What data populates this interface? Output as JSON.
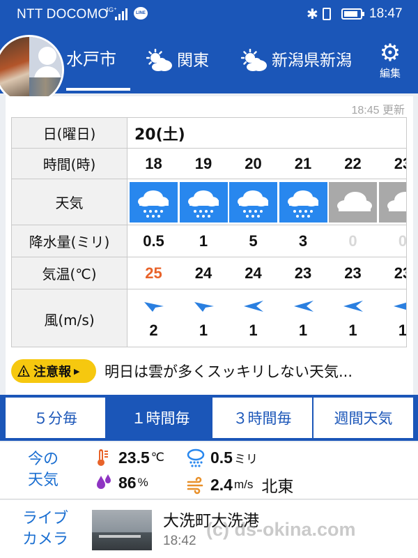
{
  "status_bar": {
    "carrier": "NTT DOCOMO",
    "network": "4G⁺",
    "line_app": "LINE",
    "time": "18:47",
    "battery_level": 0.85
  },
  "header": {
    "city_tab": "水戸市",
    "region_tabs": [
      {
        "label": "関東",
        "icon": "sun-cloud-icon"
      },
      {
        "label": "新潟県新潟",
        "icon": "sun-cloud-icon"
      }
    ],
    "settings_label": "編集",
    "accent_color": "#1b56b8"
  },
  "forecast": {
    "updated": "18:45 更新",
    "labels": {
      "date": "日(曜日)",
      "hour": "時間(時)",
      "weather": "天気",
      "precip": "降水量(ミリ)",
      "temp": "気温(℃)",
      "wind": "風(m/s)"
    },
    "date": "20(土)",
    "hours": [
      "18",
      "19",
      "20",
      "21",
      "22",
      "23"
    ],
    "weather": [
      "rain",
      "rain",
      "rain",
      "rain",
      "cloud",
      "cloud"
    ],
    "precip": [
      "0.5",
      "1",
      "5",
      "3",
      "0",
      "0"
    ],
    "temps": [
      "25",
      "24",
      "24",
      "23",
      "23",
      "23"
    ],
    "winds": [
      "2",
      "1",
      "1",
      "1",
      "1",
      "1"
    ],
    "wind_dirs": [
      "northeast",
      "northeast",
      "east",
      "east",
      "east",
      "east"
    ]
  },
  "alert": {
    "badge": "注意報",
    "message": "明日は雲が多くスッキリしない天気..."
  },
  "segments": {
    "items": [
      "５分毎",
      "１時間毎",
      "３時間毎",
      "週間天気"
    ],
    "active_index": 1
  },
  "current": {
    "title": "今の\n天気",
    "temp_value": "23.5",
    "temp_unit": "℃",
    "precip_value": "0.5",
    "precip_unit": "ミリ",
    "humidity_value": "86",
    "humidity_unit": "%",
    "wind_value": "2.4",
    "wind_unit": "m/s",
    "wind_dir": "北東"
  },
  "live_camera": {
    "title": "ライブ\nカメラ",
    "name": "大洗町大洗港",
    "time": "18:42"
  },
  "watermark": "(c) ds-okina.com"
}
